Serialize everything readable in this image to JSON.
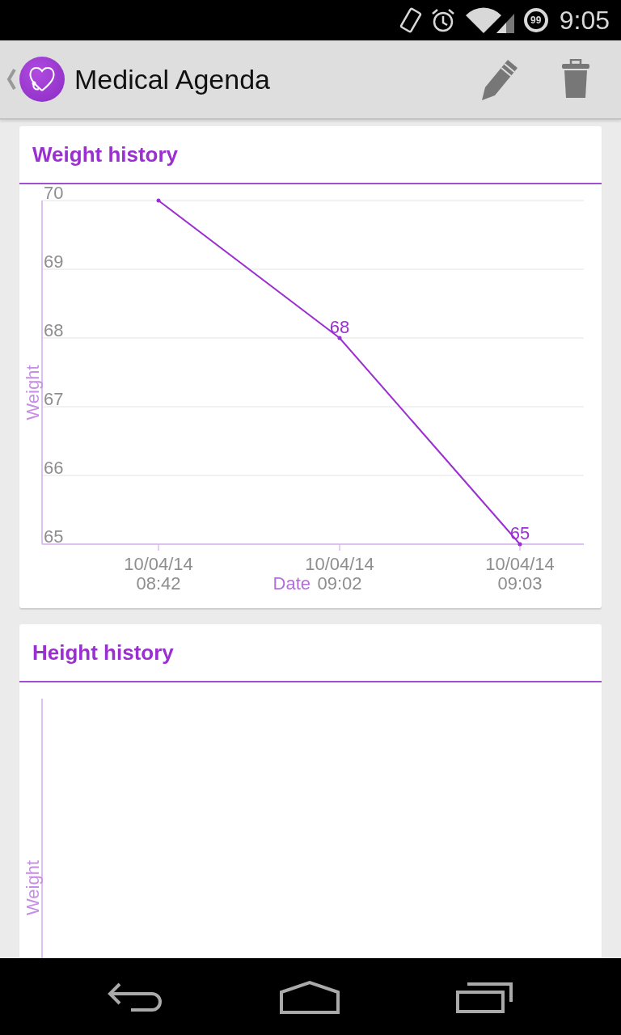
{
  "status_bar": {
    "battery": "99",
    "time": "9:05"
  },
  "action_bar": {
    "title": "Medical Agenda"
  },
  "weight_card": {
    "title": "Weight history",
    "chart_data": {
      "type": "line",
      "xlabel": "Date",
      "ylabel": "Weight",
      "categories": [
        "10/04/14\n08:42",
        "10/04/14\n09:02",
        "10/04/14\n09:03"
      ],
      "series": [
        {
          "color": "#9b30d0",
          "values": [
            70,
            68,
            65
          ]
        }
      ],
      "grid": true,
      "ylim": [
        65,
        70
      ],
      "yticks": [
        65,
        66,
        67,
        68,
        69,
        70
      ],
      "value_labels": [
        null,
        "68",
        "65"
      ]
    }
  },
  "height_card": {
    "title": "Height history",
    "ylabel": "Weight"
  }
}
